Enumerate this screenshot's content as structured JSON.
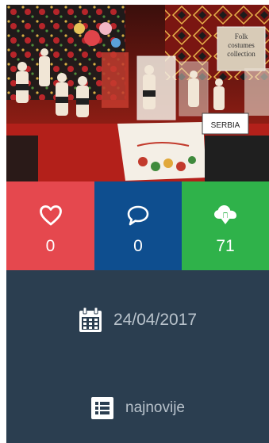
{
  "photo": {
    "alt": "",
    "sign_label": "SERBIA",
    "box_label_lines": [
      "Folk",
      "costumes",
      "collection"
    ]
  },
  "stats": {
    "likes": {
      "icon": "heart-icon",
      "value": "0",
      "color": "#e5484e"
    },
    "comments": {
      "icon": "speech-bubble-icon",
      "value": "0",
      "color": "#0e4e8f"
    },
    "downloads": {
      "icon": "cloud-download-icon",
      "value": "71",
      "color": "#2fb24a"
    }
  },
  "info": {
    "background": "#2b3e50",
    "date": {
      "icon": "calendar-icon",
      "value": "24/04/2017"
    },
    "sort": {
      "icon": "list-icon",
      "label": "najnovije"
    }
  }
}
